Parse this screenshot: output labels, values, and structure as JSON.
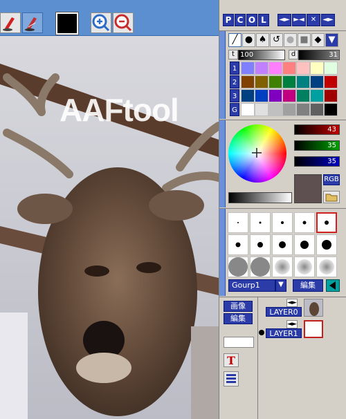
{
  "canvas": {
    "label": "",
    "watermark": "AAFtool"
  },
  "toolbar": {
    "current_color": "#000000"
  },
  "panel": {
    "menu": [
      "P",
      "C",
      "O",
      "L"
    ],
    "nav_buttons": [
      "◄►",
      "►◄",
      "✕",
      "◄►"
    ],
    "tools": [
      "pen",
      "ink",
      "blot",
      "lasso",
      "circle",
      "shape",
      "fill",
      "dropdown"
    ],
    "opacity_label": "t",
    "opacity_value": "100",
    "density_label": "d",
    "density_value": "31",
    "palette_rows": [
      "1",
      "2",
      "3",
      "G"
    ],
    "palette": [
      [
        "#8080ff",
        "#c080ff",
        "#ff80ff",
        "#ff8080",
        "#ffc0c0",
        "#ffffc0",
        "#e0ffe0"
      ],
      [
        "#804000",
        "#806000",
        "#408000",
        "#008040",
        "#008080",
        "#004080",
        "#c00000"
      ],
      [
        "#004080",
        "#0040c0",
        "#8000c0",
        "#c00080",
        "#008060",
        "#00a0a0",
        "#a00000"
      ],
      [
        "#ffffff",
        "#e0e0e0",
        "#c0c0c0",
        "#a0a0a0",
        "#808080",
        "#606060",
        "#000000"
      ]
    ],
    "rgb_r": "43",
    "rgb_g": "35",
    "rgb_b": "35",
    "rgb_label": "RGB",
    "brush_group": "Gourp1",
    "brush_edit": "編集",
    "layer_image_btn": "画像",
    "layer_edit_btn": "編集",
    "layer0": "LAYER0",
    "layer1": "LAYER1"
  }
}
